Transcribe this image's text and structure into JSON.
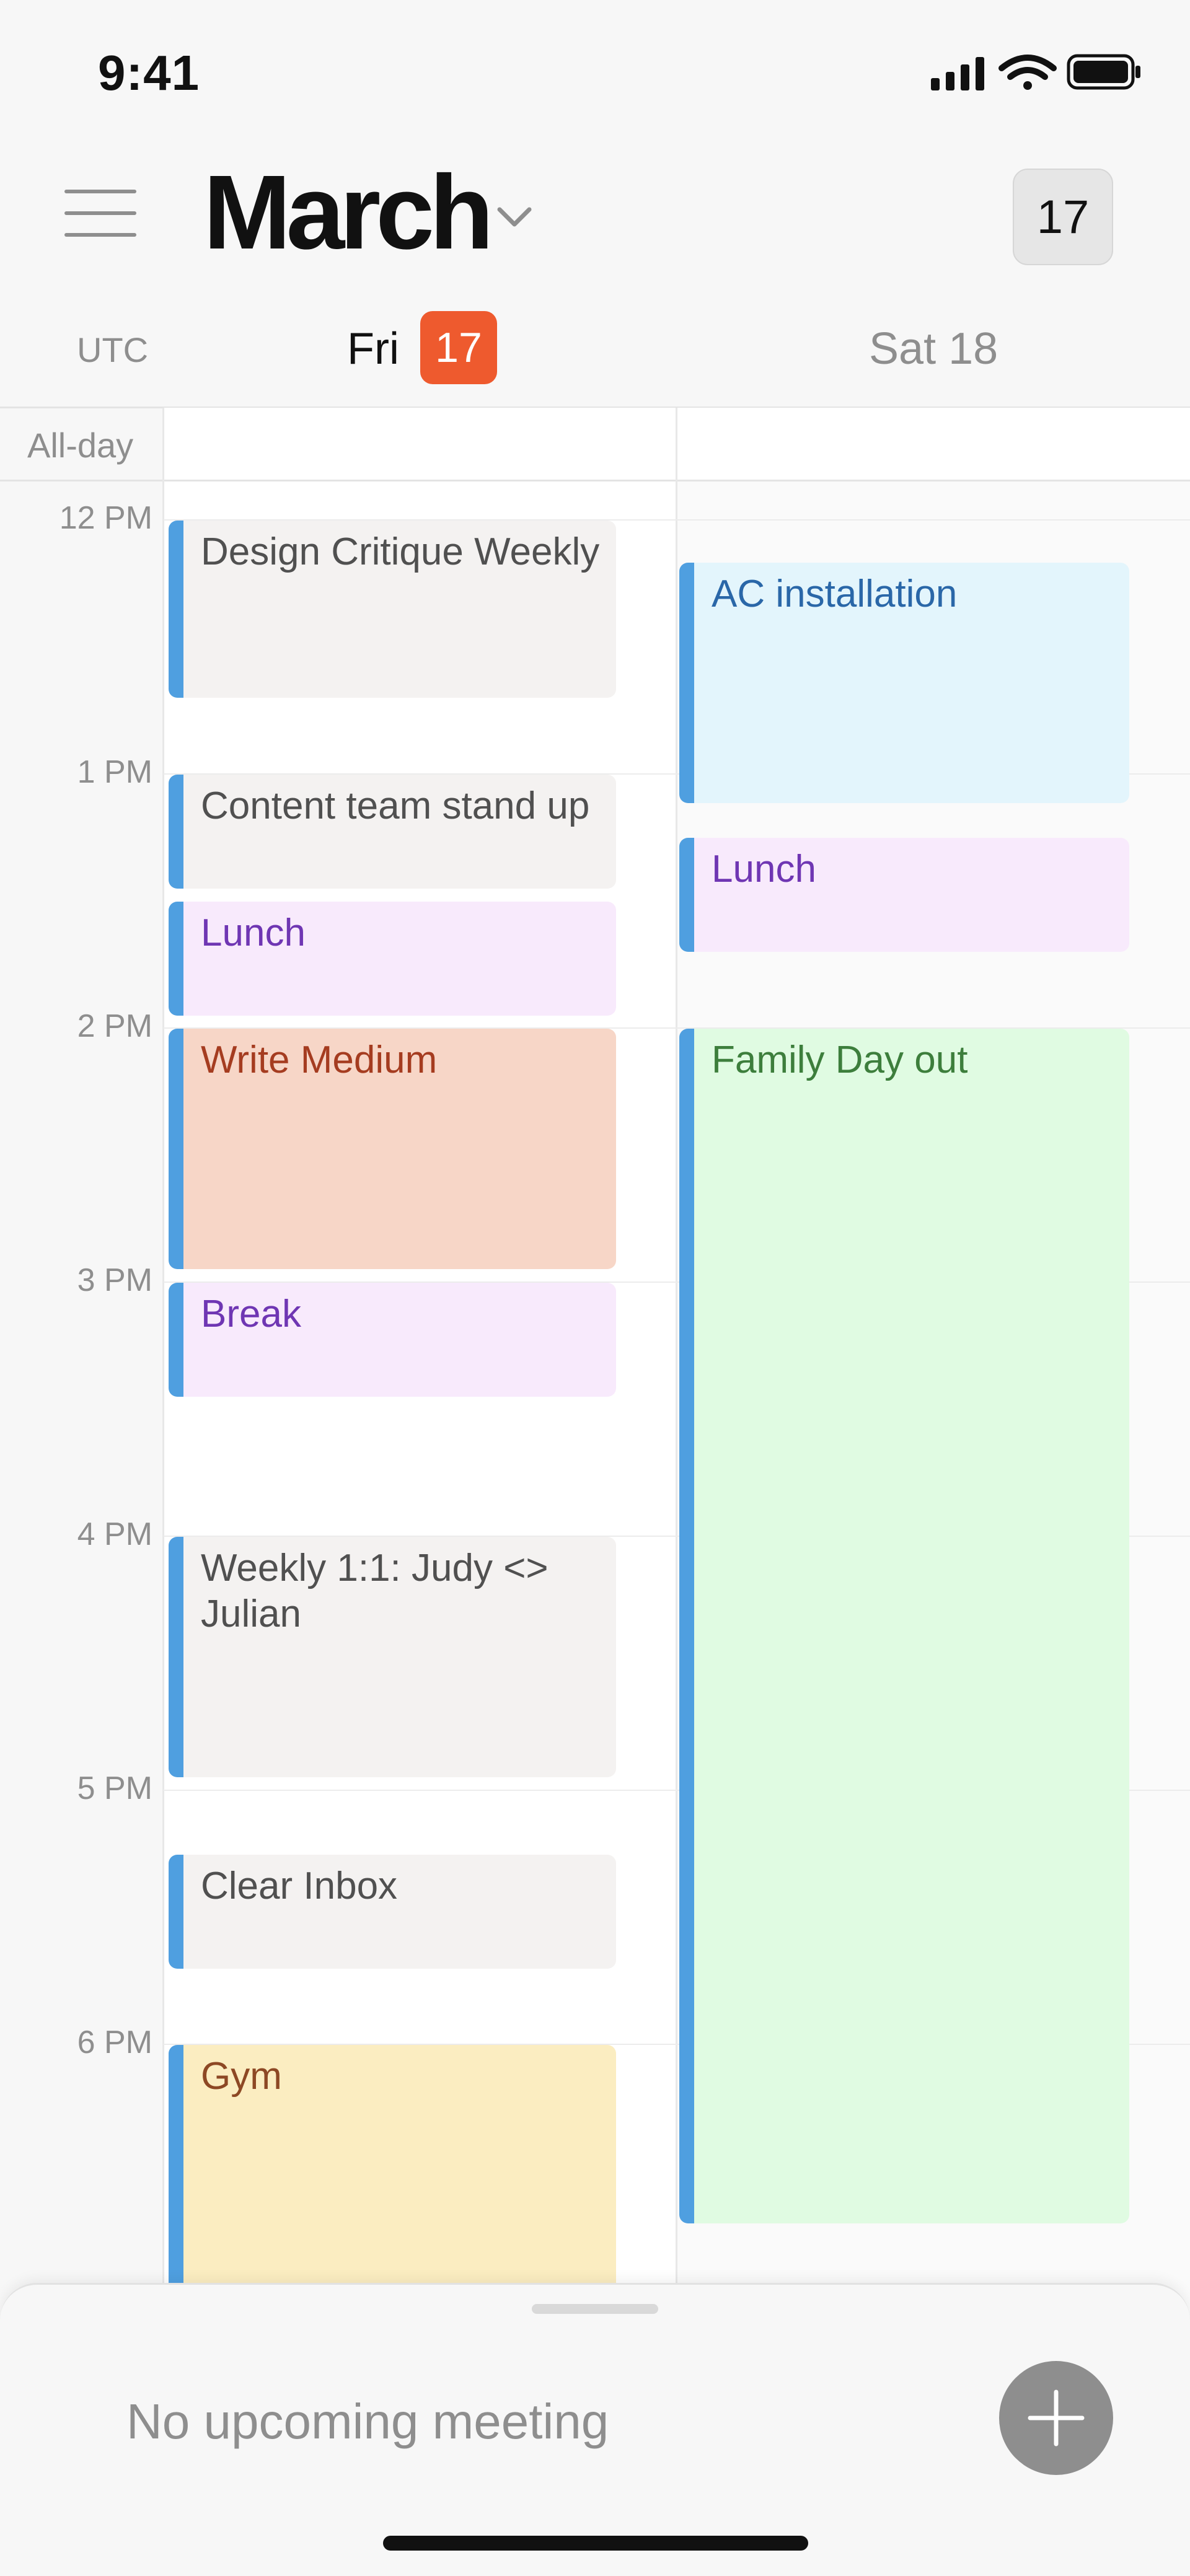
{
  "status_bar": {
    "time": "9:41",
    "icons": [
      "cellular-signal-icon",
      "wifi-icon",
      "battery-icon"
    ]
  },
  "header": {
    "menu_icon": "hamburger-menu-icon",
    "month": "March",
    "month_chevron_icon": "chevron-down-icon",
    "today_button": "17"
  },
  "day_header": {
    "timezone": "UTC",
    "days": [
      {
        "weekday": "Fri",
        "date": "17",
        "is_today": true
      },
      {
        "label": "Sat 18",
        "is_today": false
      }
    ]
  },
  "all_day": {
    "label": "All-day"
  },
  "hours": [
    "12 PM",
    "1 PM",
    "2 PM",
    "3 PM",
    "4 PM",
    "5 PM",
    "6 PM"
  ],
  "events": {
    "fri": [
      {
        "title": "Design Critique Weekly",
        "style": "grey"
      },
      {
        "title": "Content team stand up",
        "style": "grey"
      },
      {
        "title": "Lunch",
        "style": "purple"
      },
      {
        "title": "Write Medium",
        "style": "orange"
      },
      {
        "title": "Break",
        "style": "purple"
      },
      {
        "title": "Weekly 1:1: Judy <> Julian",
        "style": "grey"
      },
      {
        "title": "Clear Inbox",
        "style": "grey"
      },
      {
        "title": "Gym",
        "style": "yellow"
      }
    ],
    "sat": [
      {
        "title": "AC installation",
        "style": "blue"
      },
      {
        "title": "Lunch",
        "style": "purple"
      },
      {
        "title": "Family Day out",
        "style": "green"
      }
    ]
  },
  "bottom_sheet": {
    "message": "No upcoming meeting",
    "add_icon": "plus-icon"
  },
  "colors": {
    "today_badge": "#ee5a2e",
    "event_accent": "#4f9fe0",
    "grey_event": "#f4f2f1",
    "purple_event": "#f8eafc",
    "orange_event": "#f7d6c7",
    "blue_event": "#e3f5fc",
    "green_event": "#e0fbe2",
    "yellow_event": "#fbedc1"
  }
}
